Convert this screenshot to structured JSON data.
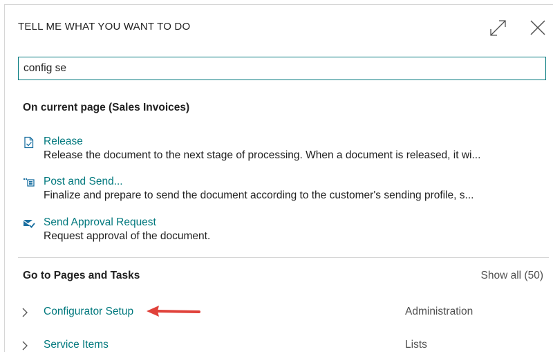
{
  "header": {
    "title": "TELL ME WHAT YOU WANT TO DO"
  },
  "search": {
    "value": "config se"
  },
  "current_page": {
    "heading": "On current page (Sales Invoices)",
    "actions": [
      {
        "icon": "document-release-icon",
        "label": "Release",
        "description": "Release the document to the next stage of processing. When a document is released, it wi..."
      },
      {
        "icon": "post-and-send-icon",
        "label": "Post and Send...",
        "description": "Finalize and prepare to send the document according to the customer's sending profile, s..."
      },
      {
        "icon": "send-approval-icon",
        "label": "Send Approval Request",
        "description": "Request approval of the document."
      }
    ]
  },
  "pages_tasks": {
    "heading": "Go to Pages and Tasks",
    "show_all": "Show all (50)",
    "results": [
      {
        "label": "Configurator Setup",
        "category": "Administration"
      },
      {
        "label": "Service Items",
        "category": "Lists"
      }
    ]
  },
  "colors": {
    "accent": "#00787d",
    "annotation_arrow": "#e0413a"
  }
}
